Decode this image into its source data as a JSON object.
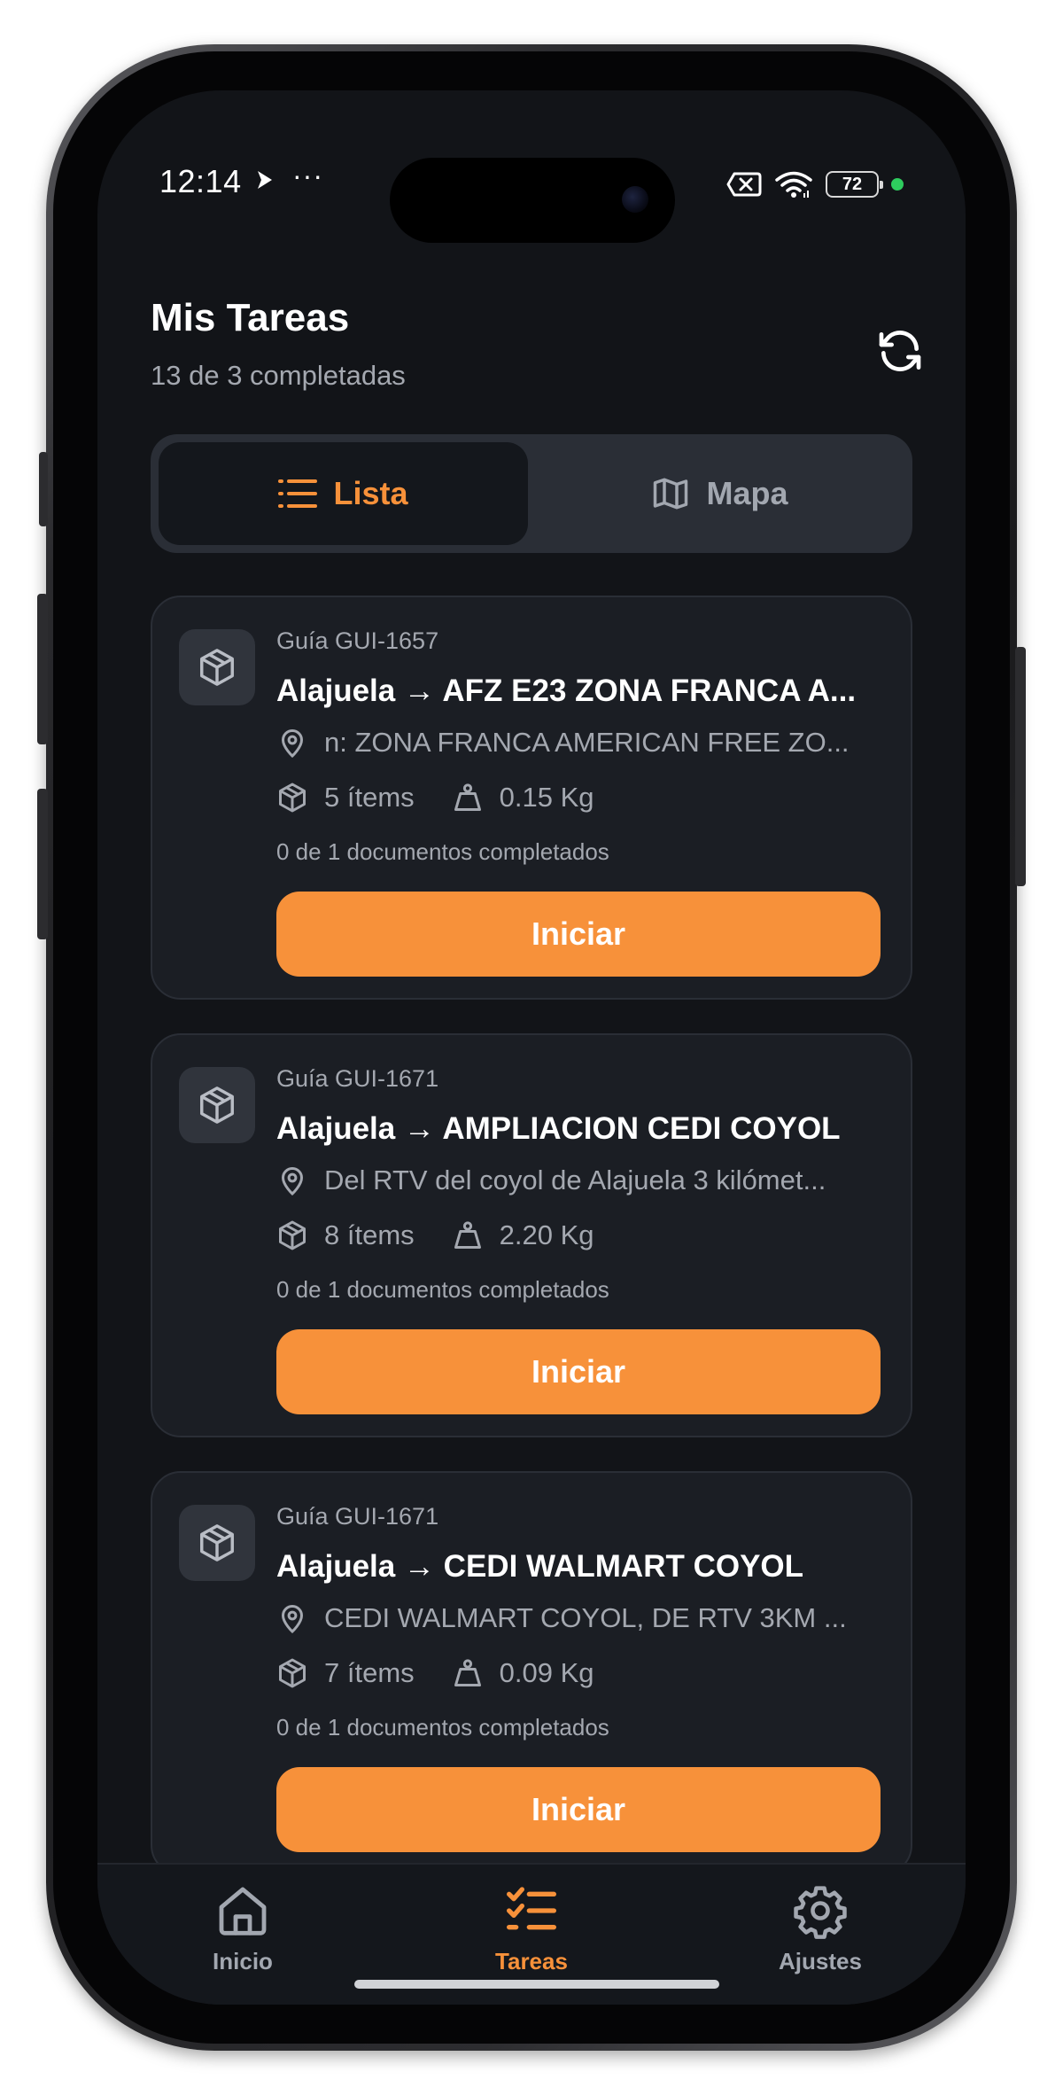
{
  "status_bar": {
    "time": "12:14",
    "dots": "···",
    "battery": "72",
    "icons": [
      "play-icon",
      "sim-off-icon",
      "wifi-icon",
      "battery-icon",
      "green-dot-indicator"
    ]
  },
  "header": {
    "title": "Mis Tareas",
    "subtitle": "13 de 3 completadas",
    "refresh_icon": "refresh-icon"
  },
  "view_toggle": {
    "list_label": "Lista",
    "map_label": "Mapa",
    "active": "list"
  },
  "tasks": [
    {
      "guide": "Guía GUI-1657",
      "route": "Alajuela → AFZ E23 ZONA FRANCA A...",
      "address": "n: ZONA FRANCA AMERICAN FREE ZO...",
      "items": "5 ítems",
      "weight": "0.15 Kg",
      "docs": "0 de 1 documentos completados",
      "button": "Iniciar"
    },
    {
      "guide": "Guía GUI-1671",
      "route": "Alajuela → AMPLIACION CEDI COYOL",
      "address": "Del RTV del coyol de Alajuela 3 kilómet...",
      "items": "8 ítems",
      "weight": "2.20 Kg",
      "docs": "0 de 1 documentos completados",
      "button": "Iniciar"
    },
    {
      "guide": "Guía GUI-1671",
      "route": "Alajuela → CEDI WALMART COYOL",
      "address": "CEDI WALMART COYOL, DE RTV 3KM ...",
      "items": "7 ítems",
      "weight": "0.09 Kg",
      "docs": "0 de 1 documentos completados",
      "button": "Iniciar"
    }
  ],
  "bottom_nav": {
    "items": [
      {
        "label": "Inicio",
        "icon": "home-icon"
      },
      {
        "label": "Tareas",
        "icon": "tasks-checklist-icon",
        "active": true
      },
      {
        "label": "Ajustes",
        "icon": "gear-icon"
      }
    ]
  },
  "colors": {
    "accent": "#f7913a",
    "background": "#121418",
    "card": "#1b1e24",
    "muted_text": "#a4a8b0",
    "status_dot": "#2ecc5e"
  }
}
